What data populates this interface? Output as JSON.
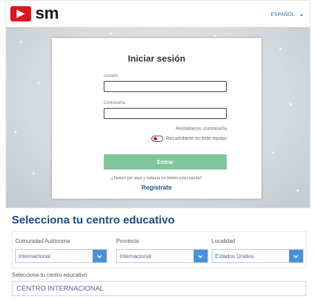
{
  "header": {
    "logo_text": "sm",
    "language": "ESPAÑOL",
    "language_chevron": "chevron-down-icon"
  },
  "login": {
    "title": "Iniciar sesión",
    "username_label": "Usuario",
    "username_value": "",
    "password_label": "Contraseña",
    "password_value": "",
    "reset_link": "Restablecer contraseña",
    "remember_label": "Recuérdame en este equipo",
    "submit_label": "Entrar",
    "new_user_text": "¿Nuevo por aquí y todavía no tienes una cuenta?",
    "register_link": "Regístrate"
  },
  "school": {
    "title": "Selecciona tu centro educativo",
    "filters": [
      {
        "label": "Comunidad Autónoma",
        "value": "Internacional"
      },
      {
        "label": "Provincia",
        "value": "Internacional"
      },
      {
        "label": "Localidad",
        "value": "Estados Unidos"
      }
    ],
    "centro_label": "Selecciona tu centro educativo",
    "centro_value": "CENTRO INTERNACIONAL"
  },
  "colors": {
    "brand_red": "#e0141e",
    "submit_green": "#7fc79a",
    "link_blue": "#1e5aa8",
    "select_button_blue": "#4a90d9"
  }
}
